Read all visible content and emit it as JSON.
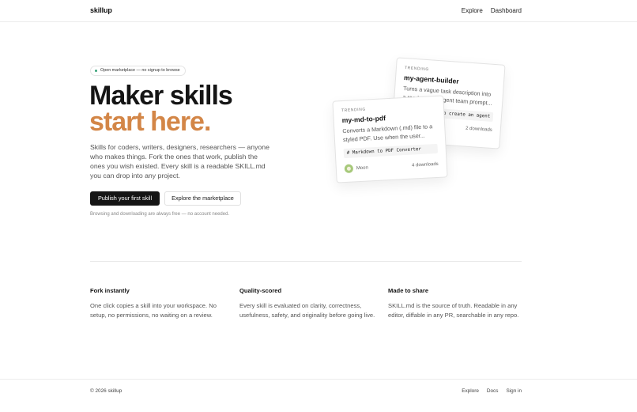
{
  "header": {
    "logo": "skillup",
    "nav": [
      "Explore",
      "Dashboard"
    ]
  },
  "hero": {
    "badge": "Open marketplace — no signup to browse",
    "title_line1": "Maker skills",
    "title_line2": "start here.",
    "description": "Skills for coders, writers, designers, researchers — anyone who makes things. Fork the ones that work, publish the ones you wish existed. Every skill is a readable SKILL.md you can drop into any project.",
    "primary_button": "Publish your first skill",
    "secondary_button": "Explore the marketplace",
    "note": "Browsing and downloading are always free — no account needed."
  },
  "cards": {
    "back": {
      "label": "TRENDING",
      "name": "my-agent-builder",
      "description": "Turns a vague task description into a ready-to-run agent team prompt...",
      "code": "# Skill: How to create an agent",
      "downloads": "2 downloads"
    },
    "front": {
      "label": "TRENDING",
      "name": "my-md-to-pdf",
      "description": "Converts a Markdown (.md) file to a styled PDF. Use when the user...",
      "code": "# Markdown to PDF Converter",
      "author": "Moon",
      "downloads": "4 downloads"
    }
  },
  "features": [
    {
      "title": "Fork instantly",
      "body": "One click copies a skill into your workspace. No setup, no permissions, no waiting on a review."
    },
    {
      "title": "Quality-scored",
      "body": "Every skill is evaluated on clarity, correctness, usefulness, safety, and originality before going live."
    },
    {
      "title": "Made to share",
      "body": "SKILL.md is the source of truth. Readable in any editor, diffable in any PR, searchable in any repo."
    }
  ],
  "footer": {
    "copyright": "© 2026 skillup",
    "links": [
      "Explore",
      "Docs",
      "Sign in"
    ]
  },
  "colors": {
    "accent": "#d38647",
    "primary": "#151515",
    "badge_dot": "#3aa37a"
  }
}
